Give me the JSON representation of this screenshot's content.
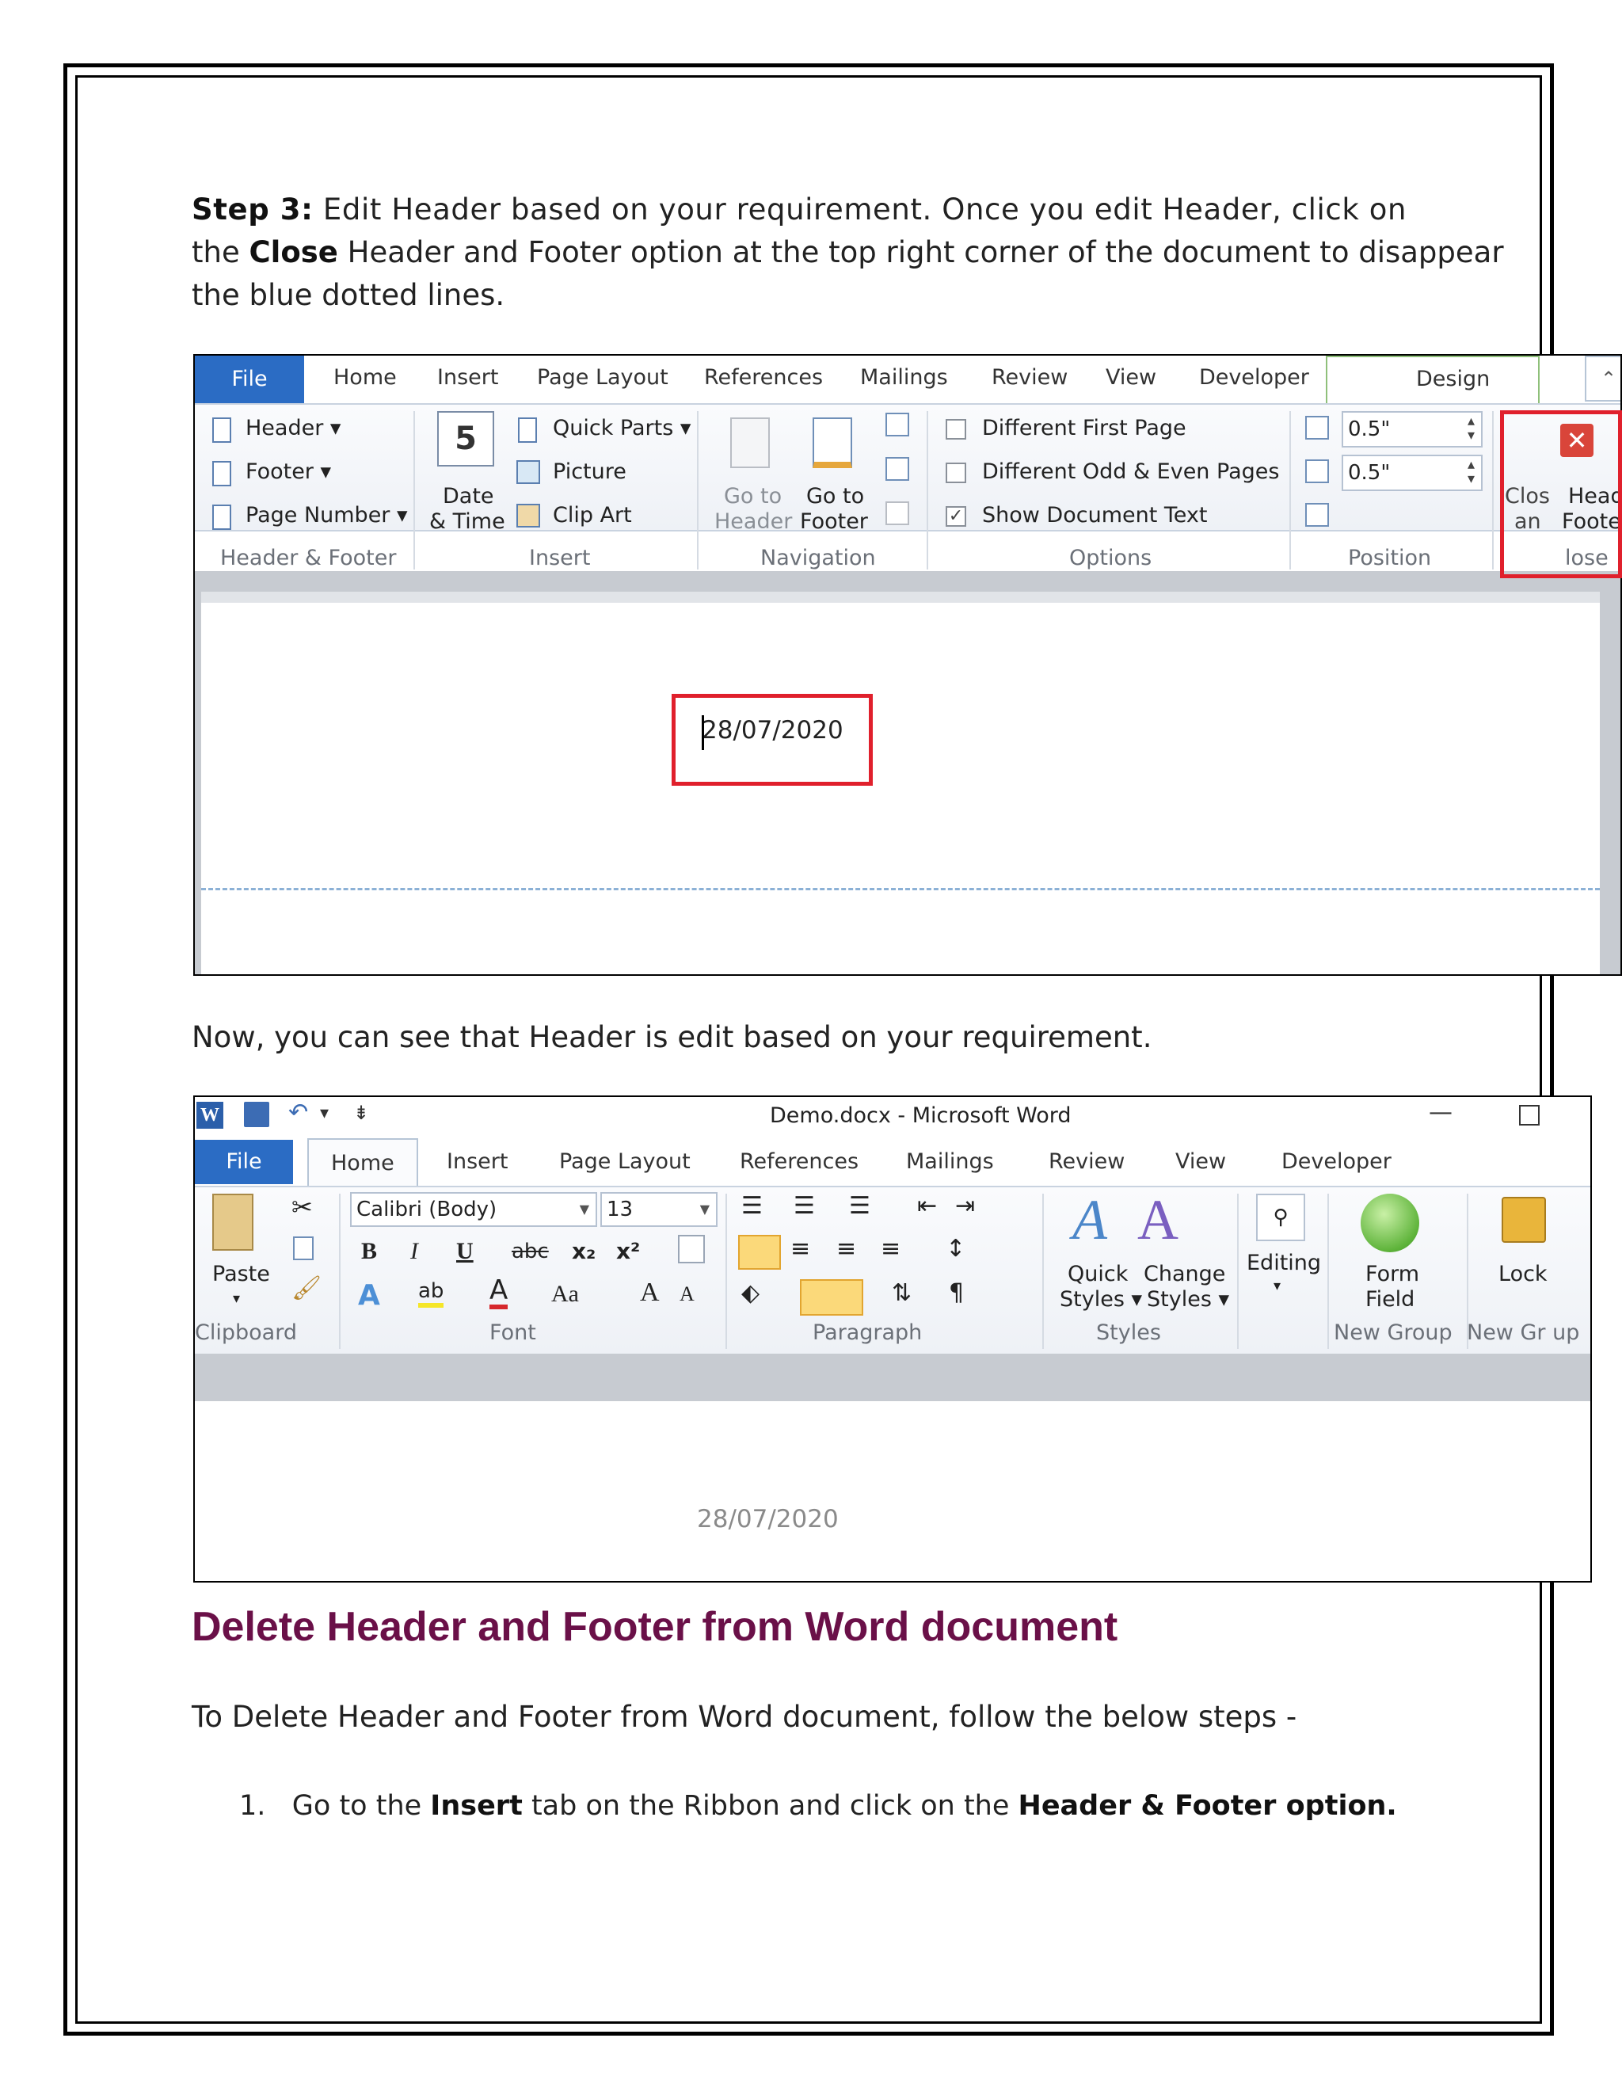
{
  "step3": {
    "label": "Step 3:",
    "text1": " Edit Header based on your requirement. Once you edit Header, click on",
    "text2_pre": "the ",
    "text2_bold": "Close",
    "text2_post": " Header and Footer option at the top right corner of the document to disappear",
    "text3": "the blue dotted lines."
  },
  "shot1": {
    "tabs": [
      "File",
      "Home",
      "Insert",
      "Page Layout",
      "References",
      "Mailings",
      "Review",
      "View",
      "Developer",
      "Design"
    ],
    "header_footer_group": {
      "header": "Header ▾",
      "footer": "Footer ▾",
      "page_number": "Page Number ▾",
      "label": "Header & Footer"
    },
    "insert_group": {
      "date1": "Date",
      "date2": "& Time",
      "quick_parts": "Quick Parts ▾",
      "picture": "Picture",
      "clip_art": "Clip Art",
      "label": "Insert",
      "calendar_number": "5"
    },
    "navigation_group": {
      "goto_header1": "Go to",
      "goto_header2": "Header",
      "goto_footer1": "Go to",
      "goto_footer2": "Footer",
      "label": "Navigation"
    },
    "options_group": {
      "diff_first": "Different First Page",
      "diff_odd_even": "Different Odd & Even Pages",
      "show_doc_text": "Show Document Text",
      "label": "Options"
    },
    "position_group": {
      "top_value": "0.5\"",
      "bottom_value": "0.5\"",
      "label": "Position"
    },
    "close_group": {
      "close1": "Clos",
      "close2": "an",
      "hf1": "Head",
      "hf2": "Foote",
      "label": "lose"
    },
    "date_text": "28/07/2020"
  },
  "para2": "Now, you can see that Header is edit based on your requirement.",
  "shot2": {
    "title": "Demo.docx - Microsoft Word",
    "tabs": [
      "File",
      "Home",
      "Insert",
      "Page Layout",
      "References",
      "Mailings",
      "Review",
      "View",
      "Developer"
    ],
    "clipboard": {
      "paste": "Paste",
      "label": "Clipboard"
    },
    "font": {
      "name": "Calibri (Body)",
      "size": "13",
      "label": "Font",
      "bold": "B",
      "italic": "I",
      "underline": "U",
      "strike": "abc",
      "sub": "x₂",
      "sup": "x²",
      "case": "Aa",
      "grow": "A",
      "shrink": "A"
    },
    "paragraph": {
      "label": "Paragraph",
      "pilcrow": "¶"
    },
    "styles": {
      "quick1": "Quick",
      "quick2": "Styles ▾",
      "change1": "Change",
      "change2": "Styles ▾",
      "label": "Styles"
    },
    "editing": "Editing",
    "form_field": {
      "line1": "Form",
      "line2": "Field",
      "label": "New Group"
    },
    "lock": {
      "text": "Lock",
      "label": "New Gr up"
    },
    "date_text": "28/07/2020"
  },
  "heading": "Delete Header and Footer from Word document",
  "para3": "To Delete Header and Footer from Word document, follow the below steps -",
  "list": {
    "num": "1.",
    "pre": "Go to the ",
    "bold1": "Insert",
    "mid": " tab on the Ribbon and click on the ",
    "bold2": "Header & Footer option."
  },
  "colors": {
    "accent_red": "#e0202c",
    "heading": "#6a1048",
    "file_tab": "#2b6cc4"
  }
}
